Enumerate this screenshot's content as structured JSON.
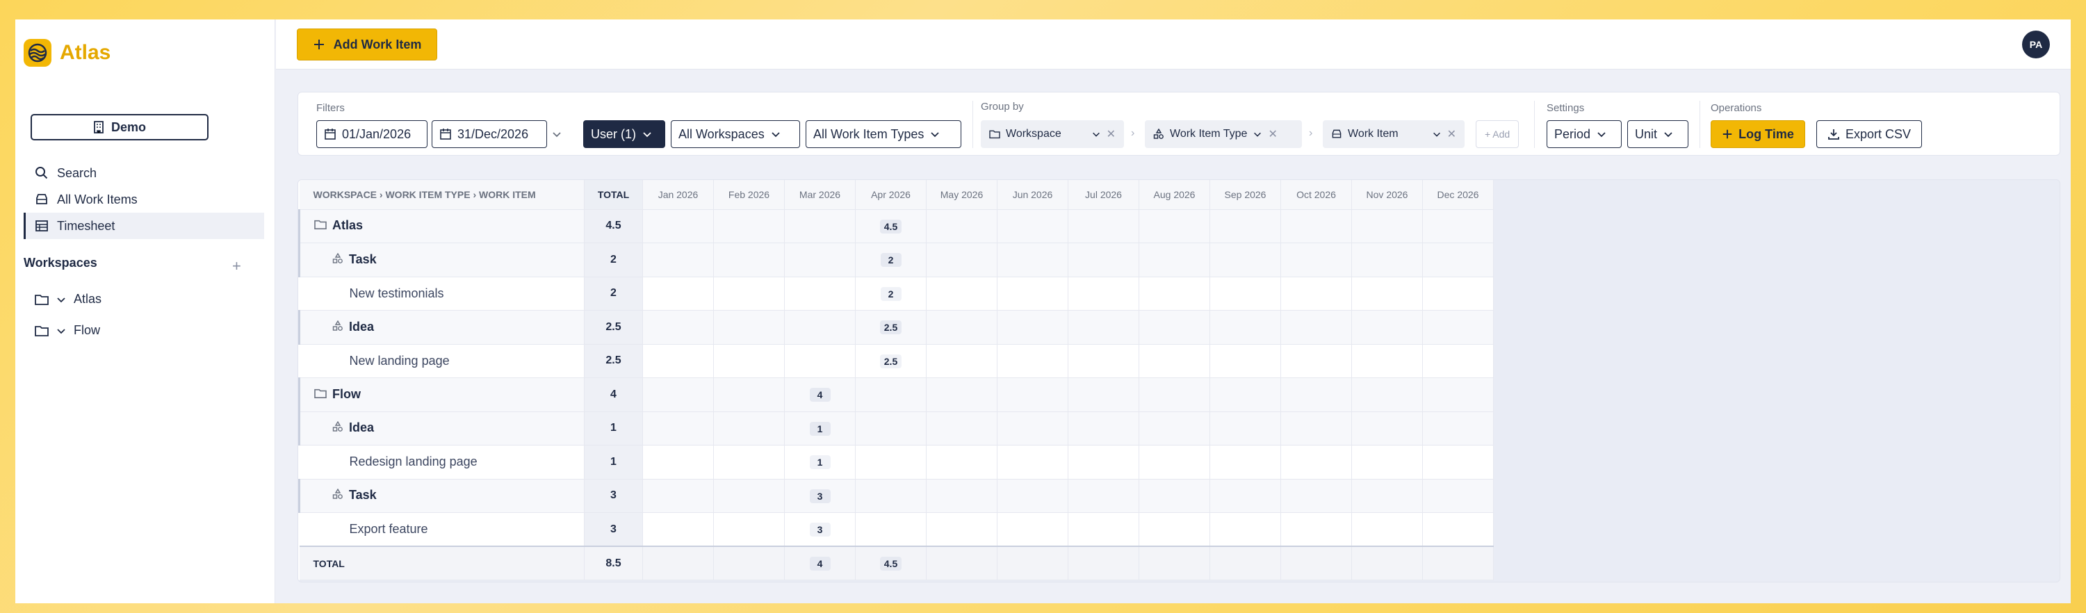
{
  "app": {
    "name": "Atlas"
  },
  "sidebar": {
    "project_button": "Demo",
    "nav": [
      {
        "label": "Search",
        "icon": "search-icon"
      },
      {
        "label": "All Work Items",
        "icon": "inbox-icon"
      },
      {
        "label": "Timesheet",
        "icon": "table-icon",
        "active": true
      }
    ],
    "workspaces_title": "Workspaces",
    "workspaces_add": "+",
    "workspaces": [
      {
        "label": "Atlas"
      },
      {
        "label": "Flow"
      }
    ]
  },
  "topbar": {
    "add_button": "Add Work Item",
    "avatar": "PA"
  },
  "filters": {
    "label": "Filters",
    "date_from": "01/Jan/2026",
    "date_to": "31/Dec/2026",
    "user": "User (1)",
    "workspaces": "All Workspaces",
    "types": "All Work Item Types"
  },
  "group_by": {
    "label": "Group by",
    "chips": [
      "Workspace",
      "Work Item Type",
      "Work Item"
    ],
    "add": "+ Add"
  },
  "settings": {
    "label": "Settings",
    "period": "Period",
    "unit": "Unit"
  },
  "operations": {
    "label": "Operations",
    "log_time": "Log Time",
    "export": "Export CSV"
  },
  "table": {
    "header_name": "WORKSPACE › WORK ITEM TYPE › WORK ITEM",
    "header_total": "TOTAL",
    "months": [
      "Jan 2026",
      "Feb 2026",
      "Mar 2026",
      "Apr 2026",
      "May 2026",
      "Jun 2026",
      "Jul 2026",
      "Aug 2026",
      "Sep 2026",
      "Oct 2026",
      "Nov 2026",
      "Dec 2026"
    ],
    "rows": [
      {
        "level": 0,
        "name": "Atlas",
        "icon": "folder-icon",
        "total": "4.5",
        "values": [
          "",
          "",
          "",
          "4.5",
          "",
          "",
          "",
          "",
          "",
          "",
          "",
          ""
        ]
      },
      {
        "level": 1,
        "name": "Task",
        "icon": "shapes-icon",
        "total": "2",
        "values": [
          "",
          "",
          "",
          "2",
          "",
          "",
          "",
          "",
          "",
          "",
          "",
          ""
        ]
      },
      {
        "level": 2,
        "name": "New testimonials",
        "total": "2",
        "values": [
          "",
          "",
          "",
          "2",
          "",
          "",
          "",
          "",
          "",
          "",
          "",
          ""
        ]
      },
      {
        "level": 1,
        "name": "Idea",
        "icon": "shapes-icon",
        "total": "2.5",
        "values": [
          "",
          "",
          "",
          "2.5",
          "",
          "",
          "",
          "",
          "",
          "",
          "",
          ""
        ]
      },
      {
        "level": 2,
        "name": "New landing page",
        "total": "2.5",
        "values": [
          "",
          "",
          "",
          "2.5",
          "",
          "",
          "",
          "",
          "",
          "",
          "",
          ""
        ]
      },
      {
        "level": 0,
        "name": "Flow",
        "icon": "folder-icon",
        "total": "4",
        "values": [
          "",
          "",
          "4",
          "",
          "",
          "",
          "",
          "",
          "",
          "",
          "",
          ""
        ]
      },
      {
        "level": 1,
        "name": "Idea",
        "icon": "shapes-icon",
        "total": "1",
        "values": [
          "",
          "",
          "1",
          "",
          "",
          "",
          "",
          "",
          "",
          "",
          "",
          ""
        ]
      },
      {
        "level": 2,
        "name": "Redesign landing page",
        "total": "1",
        "values": [
          "",
          "",
          "1",
          "",
          "",
          "",
          "",
          "",
          "",
          "",
          "",
          ""
        ]
      },
      {
        "level": 1,
        "name": "Task",
        "icon": "shapes-icon",
        "total": "3",
        "values": [
          "",
          "",
          "3",
          "",
          "",
          "",
          "",
          "",
          "",
          "",
          "",
          ""
        ]
      },
      {
        "level": 2,
        "name": "Export feature",
        "total": "3",
        "values": [
          "",
          "",
          "3",
          "",
          "",
          "",
          "",
          "",
          "",
          "",
          "",
          ""
        ]
      }
    ],
    "total_row": {
      "name": "TOTAL",
      "total": "8.5",
      "values": [
        "",
        "",
        "4",
        "4.5",
        "",
        "",
        "",
        "",
        "",
        "",
        "",
        ""
      ]
    }
  }
}
